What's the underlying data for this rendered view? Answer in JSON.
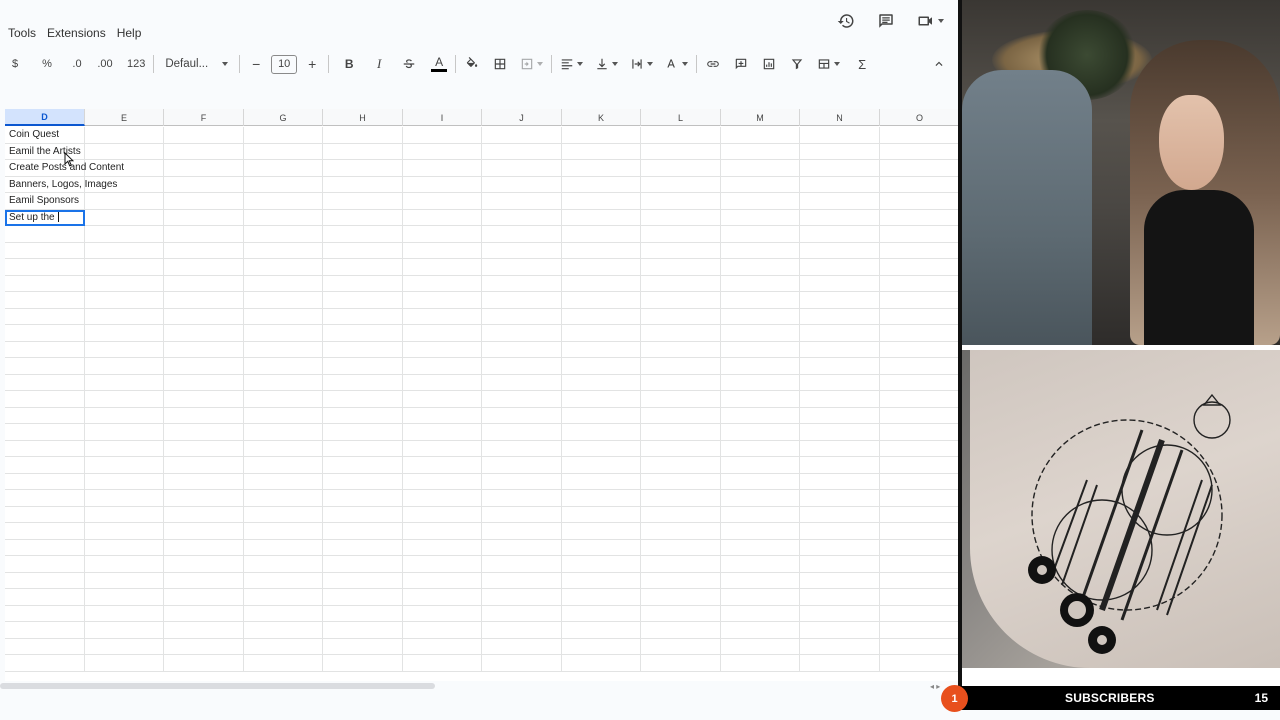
{
  "menu": {
    "items": [
      "Tools",
      "Extensions",
      "Help"
    ]
  },
  "top_icons": [
    "history-icon",
    "comment-icon",
    "meet-icon"
  ],
  "toolbar": {
    "currency": "$",
    "percent": "%",
    "decrease_decimal": ".0",
    "increase_decimal": ".00",
    "number_format": "123",
    "font": "Defaul...",
    "font_size": "10",
    "minus": "−",
    "plus": "+",
    "bold": "B",
    "italic": "I",
    "sigma": "Σ"
  },
  "sheet": {
    "columns": [
      "D",
      "E",
      "F",
      "G",
      "H",
      "I",
      "J",
      "K",
      "L",
      "M",
      "N",
      "O"
    ],
    "active_column": "D",
    "rows": [
      "Coin Quest",
      "Eamil the Artists",
      "Create Posts and Content",
      "Banners, Logos, Images",
      "Eamil Sponsors",
      "Set up the "
    ],
    "active_row_index": 5
  },
  "overlay": {
    "notification_count": "1",
    "subscribers_label": "SUBSCRIBERS",
    "subscribers_count": "15",
    "accent": "#e8501d"
  }
}
